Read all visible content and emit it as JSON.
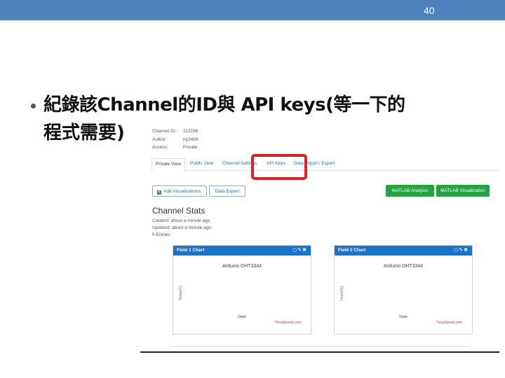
{
  "slide": {
    "page_number": "40",
    "bullet_line1": "紀錄該Channel的ID與 API keys(等一下的",
    "bullet_line2": "程式需要)"
  },
  "channel": {
    "meta": [
      {
        "key": "Channel ID:",
        "value": "113156"
      },
      {
        "key": "Author:",
        "value": "ny2400"
      },
      {
        "key": "Access:",
        "value": "Private"
      }
    ],
    "tabs": [
      "Private View",
      "Public View",
      "Channel Settings",
      "API Keys",
      "Data Import / Export"
    ],
    "buttons": {
      "add_visualizations": "Add Visualizations",
      "data_export": "Data Export",
      "matlab_analysis": "MATLAB Analysis",
      "matlab_visualization": "MATLAB Visualization"
    },
    "stats": {
      "title": "Channel Stats",
      "created": "Created: about a minute ago",
      "updated": "Updated: about a minute ago",
      "entries": "0 Entries"
    },
    "charts": [
      {
        "header": "Field 1 Chart",
        "title": "Arduino DHT3344",
        "ylabel": "Temp(C)",
        "xlabel": "Date",
        "credit": "ThingSpeak.com"
      },
      {
        "header": "Field 2 Chart",
        "title": "Arduino DHT3344",
        "ylabel": "Hum(%)",
        "xlabel": "Date",
        "credit": "ThingSpeak.com"
      }
    ]
  },
  "colors": {
    "topbar": "#4f81bd",
    "link_blue": "#1a73c9",
    "highlight_red": "#e02020",
    "button_green": "#27a243"
  },
  "icons": {
    "chart_header_icons": [
      "comment-icon",
      "pencil-icon",
      "close-icon"
    ],
    "add_icon": "plus-icon"
  }
}
